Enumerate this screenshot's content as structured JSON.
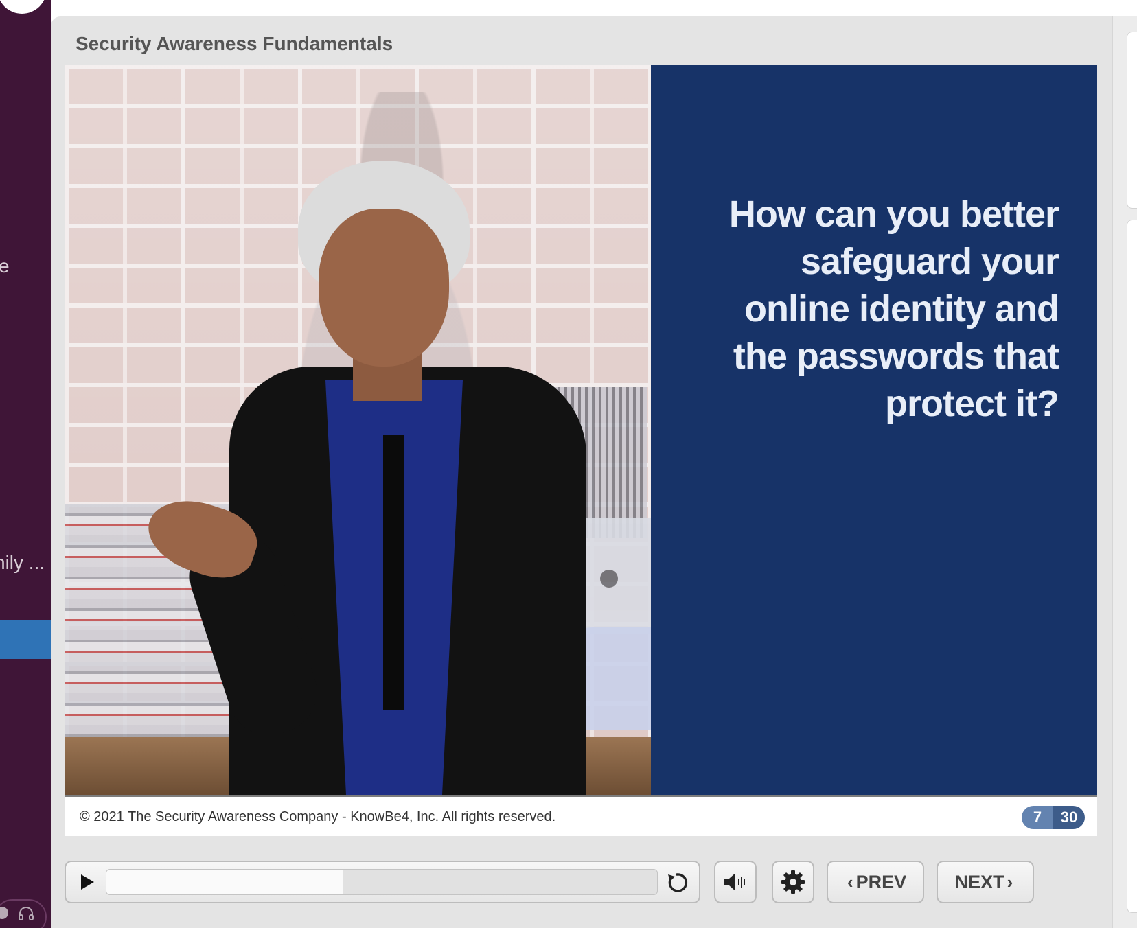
{
  "sidebar": {
    "partial_text_1": "e",
    "partial_text_2": "nily ..."
  },
  "course": {
    "title": "Security Awareness Fundamentals"
  },
  "slide": {
    "question": "How can you better safeguard your online identity and the passwords that protect it?",
    "panel_color": "#173368"
  },
  "footer": {
    "copyright": "© 2021 The Security Awareness Company - KnowBe4, Inc. All rights reserved.",
    "current_slide": "7",
    "total_slides": "30"
  },
  "controls": {
    "playback_progress": 0.43,
    "prev_label": "PREV",
    "next_label": "NEXT",
    "icons": [
      "play-icon",
      "replay-icon",
      "volume-icon",
      "settings-gear-icon",
      "chevron-left-icon",
      "chevron-right-icon"
    ]
  }
}
